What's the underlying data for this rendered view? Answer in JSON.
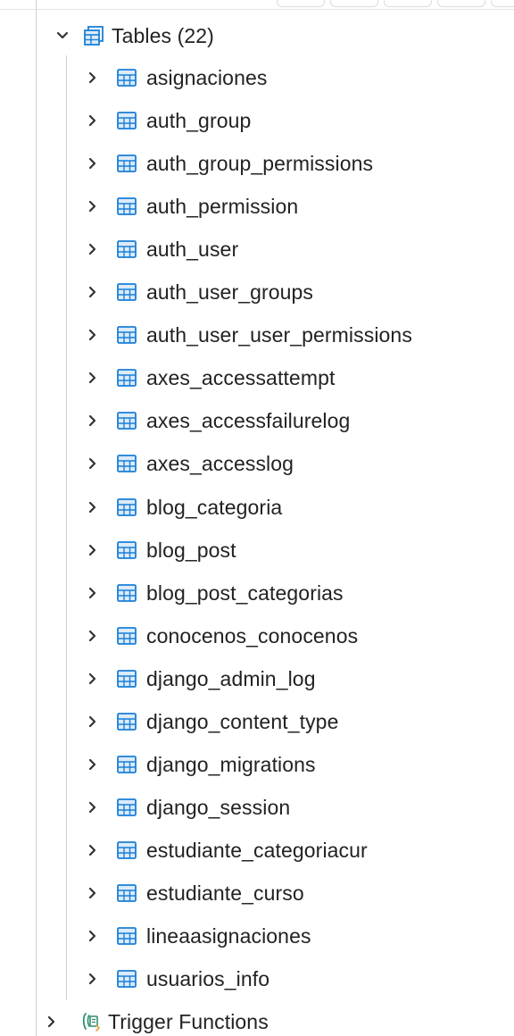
{
  "colors": {
    "table_icon": "#1a7fd6",
    "trigger_icon": "#2f8f6f",
    "text": "#222222",
    "chevron": "#333333",
    "guide_line": "#d0d0d0"
  },
  "tree": {
    "tables_group": {
      "label": "Tables (22)",
      "icon": "tables-folder-icon",
      "expanded": true
    },
    "tables": [
      {
        "label": "asignaciones"
      },
      {
        "label": "auth_group"
      },
      {
        "label": "auth_group_permissions"
      },
      {
        "label": "auth_permission"
      },
      {
        "label": "auth_user"
      },
      {
        "label": "auth_user_groups"
      },
      {
        "label": "auth_user_user_permissions"
      },
      {
        "label": "axes_accessattempt"
      },
      {
        "label": "axes_accessfailurelog"
      },
      {
        "label": "axes_accesslog"
      },
      {
        "label": "blog_categoria"
      },
      {
        "label": "blog_post"
      },
      {
        "label": "blog_post_categorias"
      },
      {
        "label": "conocenos_conocenos"
      },
      {
        "label": "django_admin_log"
      },
      {
        "label": "django_content_type"
      },
      {
        "label": "django_migrations"
      },
      {
        "label": "django_session"
      },
      {
        "label": "estudiante_categoriacur"
      },
      {
        "label": "estudiante_curso"
      },
      {
        "label": "lineaasignaciones"
      },
      {
        "label": "usuarios_info"
      }
    ],
    "trigger_functions": {
      "label": "Trigger Functions",
      "icon": "trigger-function-icon",
      "expanded": false
    }
  }
}
